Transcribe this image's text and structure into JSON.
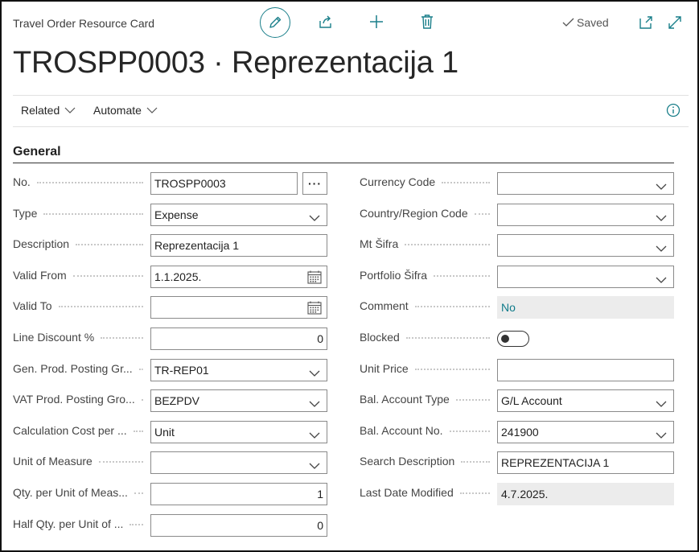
{
  "header": {
    "caption": "Travel Order Resource Card",
    "title": "TROSPP0003 · Reprezentacija 1",
    "saved_label": "Saved",
    "accent": "#1a7f8a"
  },
  "actions": {
    "related": "Related",
    "automate": "Automate"
  },
  "section": {
    "title": "General"
  },
  "left": [
    {
      "label": "No.",
      "value": "TROSPP0003",
      "kind": "text-ellipsis"
    },
    {
      "label": "Type",
      "value": "Expense",
      "kind": "select"
    },
    {
      "label": "Description",
      "value": "Reprezentacija 1",
      "kind": "text"
    },
    {
      "label": "Valid From",
      "value": "1.1.2025.",
      "kind": "date"
    },
    {
      "label": "Valid To",
      "value": "",
      "kind": "date"
    },
    {
      "label": "Line Discount %",
      "value": "0",
      "kind": "number"
    },
    {
      "label": "Gen. Prod. Posting Gr...",
      "value": "TR-REP01",
      "kind": "select"
    },
    {
      "label": "VAT Prod. Posting Gro...",
      "value": "BEZPDV",
      "kind": "select"
    },
    {
      "label": "Calculation Cost per ...",
      "value": "Unit",
      "kind": "select"
    },
    {
      "label": "Unit of Measure",
      "value": "",
      "kind": "select"
    },
    {
      "label": "Qty. per Unit of Meas...",
      "value": "1",
      "kind": "number"
    },
    {
      "label": "Half Qty. per Unit of ...",
      "value": "0",
      "kind": "number"
    }
  ],
  "right": [
    {
      "label": "Currency Code",
      "value": "",
      "kind": "select"
    },
    {
      "label": "Country/Region Code",
      "value": "",
      "kind": "select"
    },
    {
      "label": "Mt Šifra",
      "value": "",
      "kind": "select"
    },
    {
      "label": "Portfolio Šifra",
      "value": "",
      "kind": "select"
    },
    {
      "label": "Comment",
      "value": "No",
      "kind": "readonly-link"
    },
    {
      "label": "Blocked",
      "value": "",
      "kind": "toggle",
      "on": false
    },
    {
      "label": "Unit Price",
      "value": "",
      "kind": "text"
    },
    {
      "label": "Bal. Account Type",
      "value": "G/L Account",
      "kind": "select"
    },
    {
      "label": "Bal. Account No.",
      "value": "241900",
      "kind": "select"
    },
    {
      "label": "Search Description",
      "value": "REPREZENTACIJA 1",
      "kind": "text"
    },
    {
      "label": "Last Date Modified",
      "value": "4.7.2025.",
      "kind": "readonly"
    }
  ]
}
